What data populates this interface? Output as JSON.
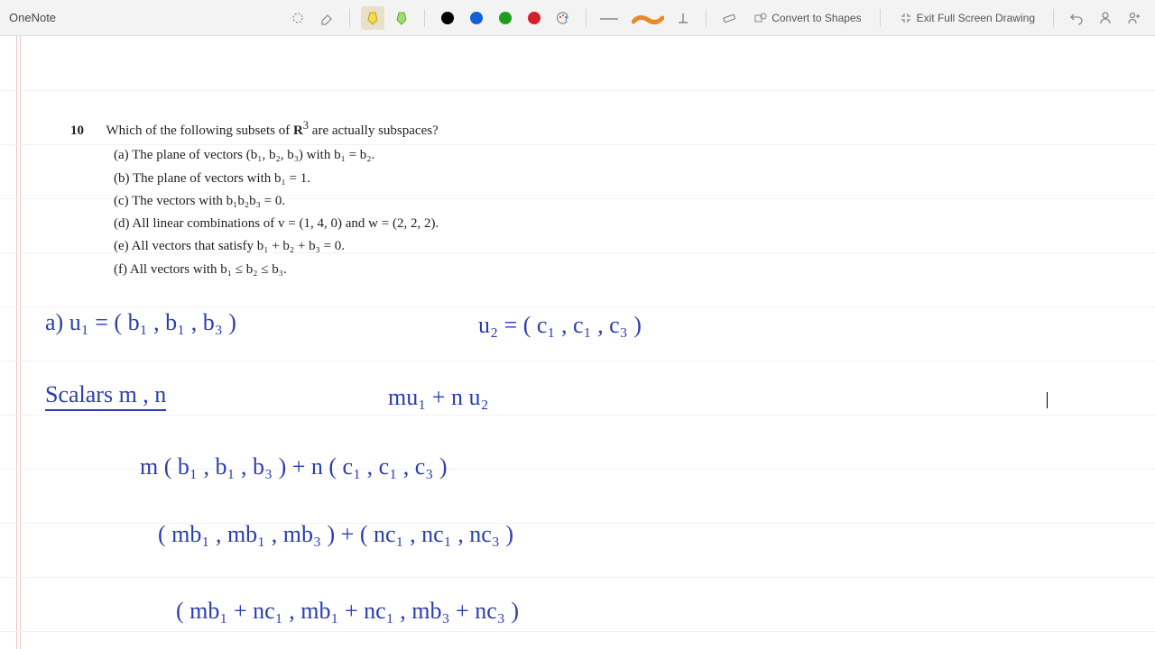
{
  "app": {
    "title": "OneNote"
  },
  "toolbar": {
    "lasso": "lasso-select",
    "eraser": "eraser",
    "hi1": "highlighter-yellow",
    "hi2": "highlighter-green",
    "colors": [
      "#000000",
      "#1560d4",
      "#1aa01a",
      "#d4202a"
    ],
    "palette": "color-picker",
    "thin": "thin-pen",
    "thick": "thick-pen",
    "ruler": "ruler",
    "convert": "Convert to Shapes",
    "exit": "Exit Full Screen Drawing",
    "undo": "undo"
  },
  "problem": {
    "number": "10",
    "stem_a": "Which of the following subsets of ",
    "stem_b": " are actually subspaces?",
    "opts": {
      "a": "(a)  The plane of vectors (b₁, b₂, b₃) with b₁ = b₂.",
      "b": "(b)  The plane of vectors with b₁ = 1.",
      "c": "(c)  The vectors with b₁b₂b₃ = 0.",
      "d": "(d)  All linear combinations of v = (1, 4, 0) and w = (2, 2, 2).",
      "e": "(e)  All vectors that satisfy b₁ + b₂ + b₃ = 0.",
      "f": "(f)  All vectors with b₁ ≤ b₂ ≤ b₃."
    }
  },
  "hand": {
    "l1a": "a)      u₁  =  ( b₁ , b₁ , b₃ )",
    "l1b": "u₂  =  ( c₁ , c₁ , c₃ )",
    "l2a": "Scalars    m , n",
    "l2b": "mu₁  +  n u₂",
    "l3": "m  ( b₁ , b₁ , b₃ )    +    n  ( c₁ , c₁ , c₃ )",
    "l4": "( mb₁ , mb₁ , mb₃ )    +   ( nc₁ , nc₁ , nc₃ )",
    "l5": "( mb₁ + nc₁  ,   mb₁ + nc₁  ,   mb₃ + nc₃ )"
  }
}
